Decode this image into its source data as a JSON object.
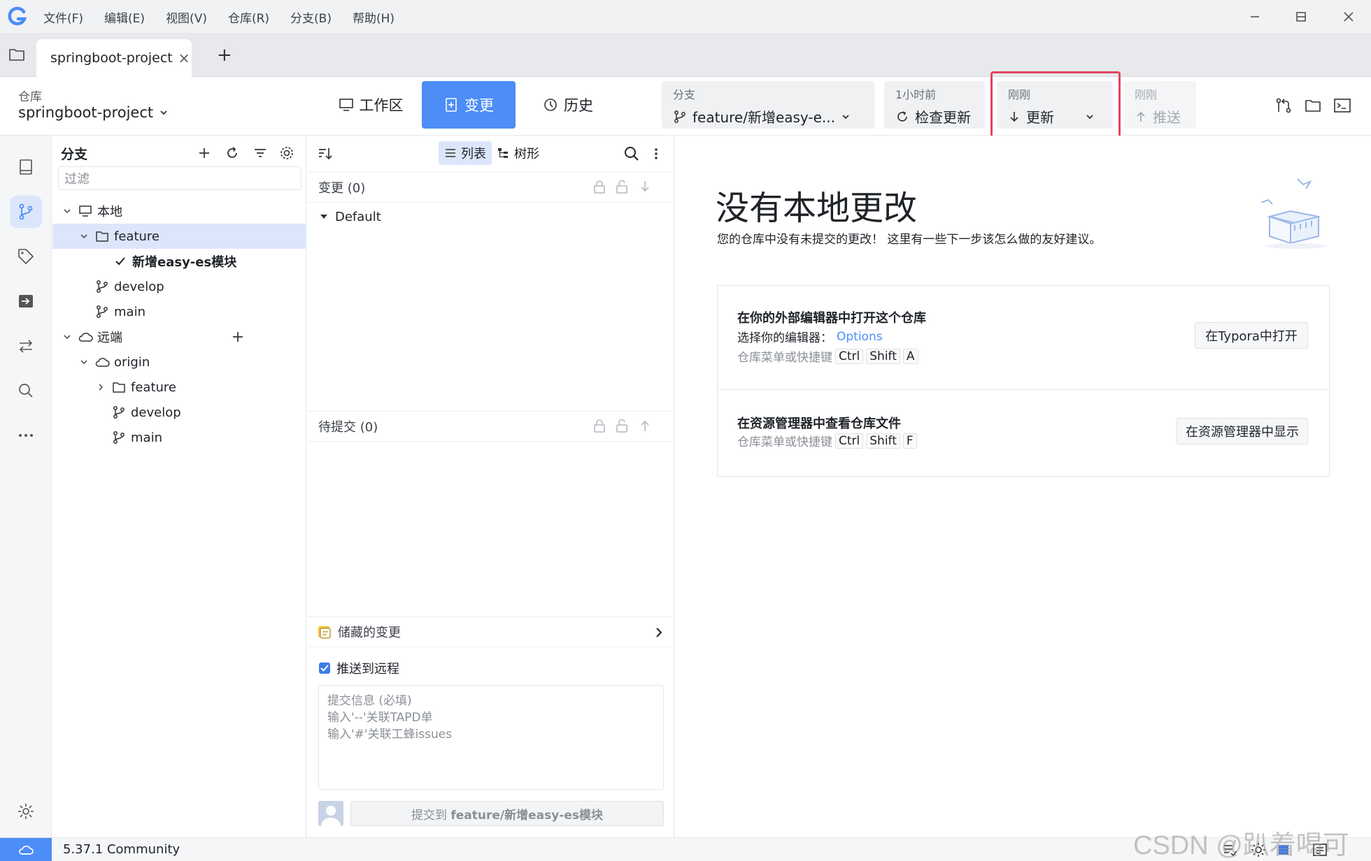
{
  "menubar": {
    "items": [
      "文件(F)",
      "编辑(E)",
      "视图(V)",
      "仓库(R)",
      "分支(B)",
      "帮助(H)"
    ]
  },
  "tabs": {
    "title": "springboot-project",
    "close": "×",
    "add": "+"
  },
  "toolbar": {
    "repo_label": "仓库",
    "repo_name": "springboot-project",
    "workspace": "工作区",
    "changes": "变更",
    "history": "历史",
    "branch_label": "分支",
    "branch_value": "feature/新增easy-e...",
    "fetch_time": "1小时前",
    "fetch_label": "检查更新",
    "pull_time": "刚刚",
    "pull_label": "更新",
    "push_time": "刚刚",
    "push_label": "推送"
  },
  "branches": {
    "title": "分支",
    "filter_placeholder": "过滤",
    "local": "本地",
    "local_feature": "feature",
    "current_branch": "新增easy-es模块",
    "develop": "develop",
    "main": "main",
    "remote": "远端",
    "origin": "origin",
    "remote_feature": "feature",
    "remote_develop": "develop",
    "remote_main": "main"
  },
  "changes": {
    "view_list": "列表",
    "view_tree": "树形",
    "unstaged": "变更 (0)",
    "default_group": "Default",
    "staged": "待提交 (0)",
    "stash": "储藏的变更",
    "push_remote": "推送到远程",
    "commit_placeholder_1": "提交信息 (必填)",
    "commit_placeholder_2": "输入'--'关联TAPD单",
    "commit_placeholder_3": "输入'#'关联工蜂issues",
    "commit_btn_prefix": "提交到 ",
    "commit_btn_branch": "feature/新增easy-es模块"
  },
  "main": {
    "heading": "没有本地更改",
    "subtitle": "您的仓库中没有未提交的更改！ 这里有一些下一步该怎么做的友好建议。",
    "card1_title": "在你的外部编辑器中打开这个仓库",
    "card1_sub": "选择你的编辑器：",
    "card1_link": "Options",
    "card1_hint": "仓库菜单或快捷键",
    "card1_k1": "Ctrl",
    "card1_k2": "Shift",
    "card1_k3": "A",
    "card1_btn": "在Typora中打开",
    "card2_title": "在资源管理器中查看仓库文件",
    "card2_hint": "仓库菜单或快捷键",
    "card2_k1": "Ctrl",
    "card2_k2": "Shift",
    "card2_k3": "F",
    "card2_btn": "在资源管理器中显示"
  },
  "statusbar": {
    "version": "5.37.1 Community"
  },
  "watermark": "CSDN @趴着喝可乐",
  "colors": {
    "accent": "#4c8df6",
    "highlight": "#e3445f",
    "selected": "#dce6fb"
  }
}
